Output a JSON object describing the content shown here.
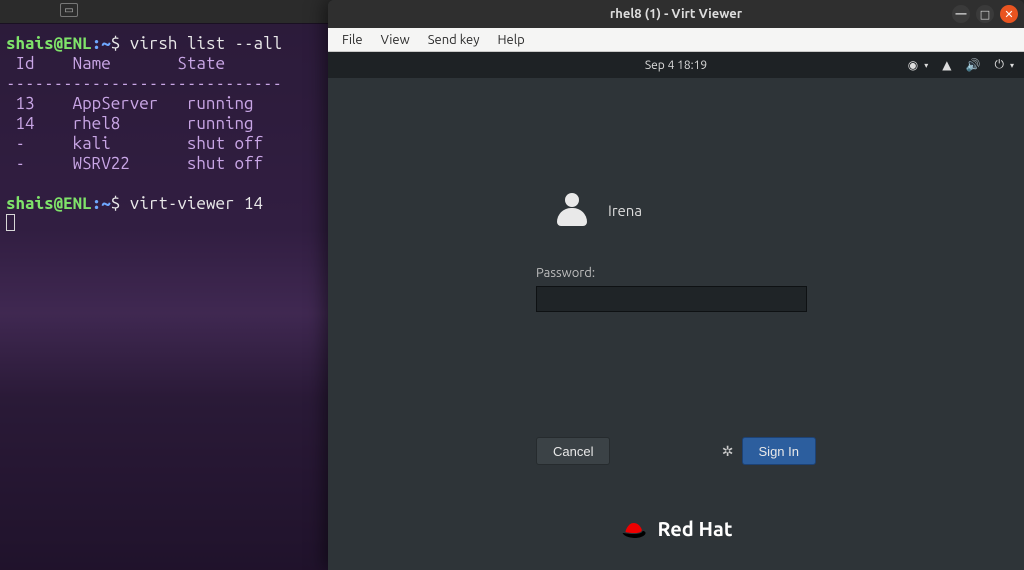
{
  "desktop_topbar": {
    "tab_icon": "▭"
  },
  "terminal": {
    "prompt": {
      "user": "shais",
      "at": "@",
      "host": "ENL",
      "path": ":~",
      "sigil": "$ "
    },
    "cmd1": "virsh list --all",
    "header_line": " Id    Name       State",
    "divider": "-----------------------------",
    "rows": [
      " 13    AppServer   running",
      " 14    rhel8       running",
      " -     kali        shut off",
      " -     WSRV22      shut off"
    ],
    "cmd2": "virt-viewer 14"
  },
  "virt_viewer": {
    "title": "rhel8 (1) - Virt Viewer",
    "menu": {
      "file": "File",
      "view": "View",
      "sendkey": "Send key",
      "help": "Help"
    },
    "win": {
      "min": "—",
      "max": "□",
      "close": "✕"
    }
  },
  "guest": {
    "clock": "Sep 4  18:19",
    "tray_icons": {
      "access": "◉",
      "net": "▲",
      "vol": "🔊",
      "power": "⏻"
    },
    "tray_caret": "▾",
    "login": {
      "user": "Irena",
      "password_label": "Password:",
      "password_value": "",
      "cancel": "Cancel",
      "signin": "Sign In",
      "gear": "✲"
    },
    "brand": "Red Hat"
  }
}
